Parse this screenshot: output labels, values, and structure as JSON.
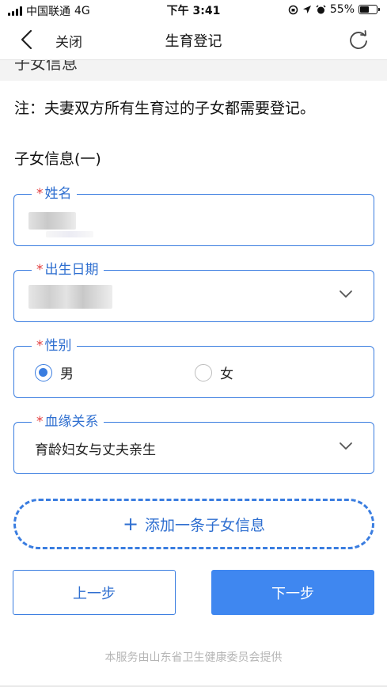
{
  "status_bar": {
    "carrier": "中国联通",
    "network": "4G",
    "time": "下午 3:41",
    "battery": "55%",
    "battery_level": 0.55
  },
  "nav": {
    "close_label": "关闭",
    "title": "生育登记",
    "icons": {
      "back": "chevron-left-icon",
      "refresh": "refresh-icon"
    }
  },
  "section_peek": "子女信息",
  "note": "注：夫妻双方所有生育过的子女都需要登记。",
  "sub_title": "子女信息(一)",
  "fields": {
    "name": {
      "label": "姓名",
      "required_mark": "*"
    },
    "birth_date": {
      "label": "出生日期",
      "required_mark": "*"
    },
    "gender": {
      "label": "性别",
      "required_mark": "*",
      "options": [
        {
          "label": "男",
          "checked": true
        },
        {
          "label": "女",
          "checked": false
        }
      ]
    },
    "relation": {
      "label": "血缘关系",
      "required_mark": "*",
      "value": "育龄妇女与丈夫亲生"
    }
  },
  "add_button": {
    "icon": "+",
    "label": "添加一条子女信息"
  },
  "prev_label": "上一步",
  "next_label": "下一步",
  "footer": "本服务由山东省卫生健康委员会提供",
  "colors": {
    "accent": "#3a7de0",
    "primary_button": "#3f87f0",
    "required": "#e23b3b"
  }
}
